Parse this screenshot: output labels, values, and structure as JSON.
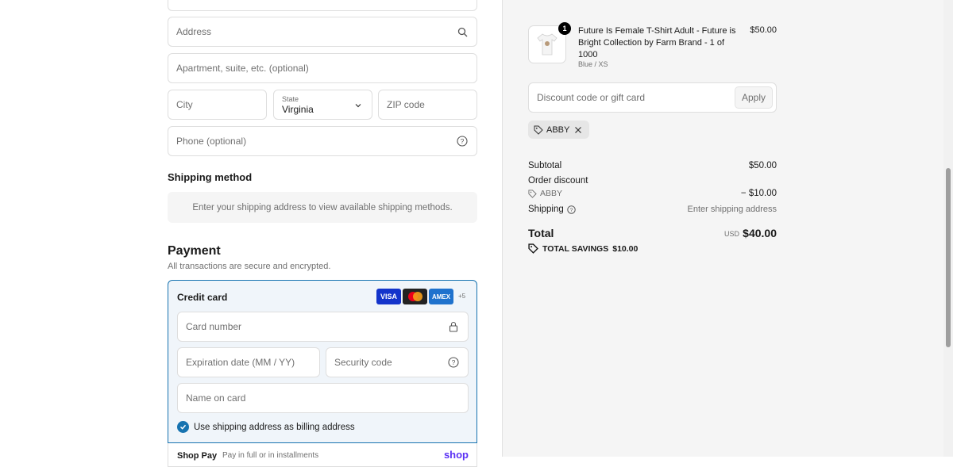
{
  "form": {
    "address_placeholder": "Address",
    "apartment_placeholder": "Apartment, suite, etc. (optional)",
    "city_placeholder": "City",
    "state_label": "State",
    "state_value": "Virginia",
    "zip_placeholder": "ZIP code",
    "phone_placeholder": "Phone (optional)"
  },
  "shipping": {
    "heading": "Shipping method",
    "note": "Enter your shipping address to view available shipping methods."
  },
  "payment": {
    "heading": "Payment",
    "subtitle": "All transactions are secure and encrypted.",
    "method_label": "Credit card",
    "card_logos": [
      "VISA",
      "Mastercard",
      "AMEX"
    ],
    "more_cards": "+5",
    "card_number_placeholder": "Card number",
    "expiry_placeholder": "Expiration date (MM / YY)",
    "security_placeholder": "Security code",
    "name_placeholder": "Name on card",
    "billing_checkbox_label": "Use shipping address as billing address",
    "billing_checked": true,
    "next_option_label": "Shop Pay",
    "next_option_sub": "Pay in full or in installments",
    "next_option_brand": "shop"
  },
  "order": {
    "product": {
      "qty": "1",
      "title": "Future Is Female T-Shirt Adult - Future is Bright Collection by Farm Brand - 1 of 1000",
      "variant": "Blue / XS",
      "price": "$50.00"
    },
    "discount_placeholder": "Discount code or gift card",
    "apply_label": "Apply",
    "applied_code": "ABBY",
    "subtotal_label": "Subtotal",
    "subtotal_value": "$50.00",
    "order_discount_label": "Order discount",
    "discount_code": "ABBY",
    "discount_value": "− $10.00",
    "shipping_label": "Shipping",
    "shipping_value": "Enter shipping address",
    "total_label": "Total",
    "currency": "USD",
    "total_value": "$40.00",
    "savings_label": "TOTAL SAVINGS",
    "savings_value": "$10.00"
  },
  "colors": {
    "accent": "#1773b0",
    "shop_brand": "#5a31f4"
  }
}
